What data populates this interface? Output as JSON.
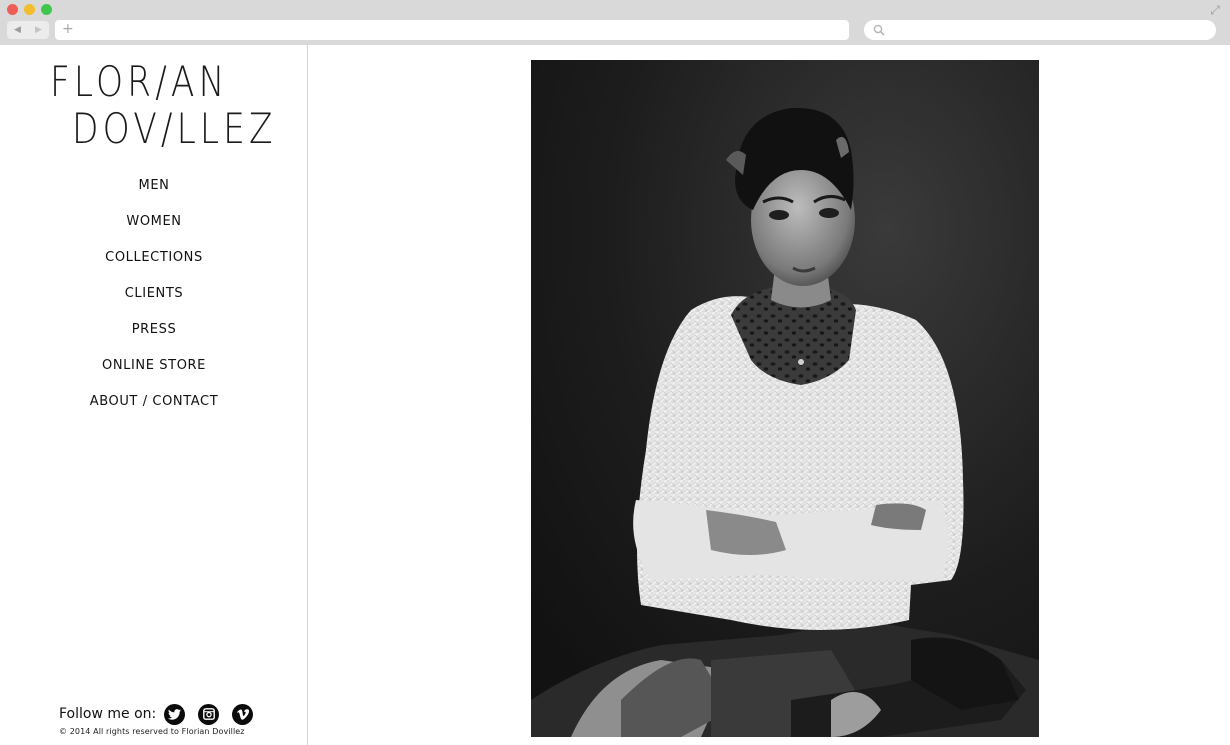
{
  "browser": {
    "back_label": "◀",
    "forward_label": "▶",
    "new_tab_label": "+",
    "expand_label": "⤢",
    "address_value": "",
    "search_value": ""
  },
  "site": {
    "logo_line1": "FLOR/AN",
    "logo_line2": "DOV/LLEZ"
  },
  "nav": {
    "items": [
      {
        "label": "MEN"
      },
      {
        "label": "WOMEN"
      },
      {
        "label": "COLLECTIONS"
      },
      {
        "label": "CLIENTS"
      },
      {
        "label": "PRESS"
      },
      {
        "label": "ONLINE STORE"
      },
      {
        "label": "ABOUT / CONTACT"
      }
    ]
  },
  "footer": {
    "follow_label": "Follow me on:",
    "social": [
      {
        "icon": "twitter-icon"
      },
      {
        "icon": "instagram-icon"
      },
      {
        "icon": "vimeo-icon"
      }
    ],
    "copyright": "© 2014 All rights reserved to Florian Dovillez"
  },
  "photo": {
    "subject": "black-and-white portrait photograph"
  },
  "colors": {
    "chrome_bg": "#d9d9d9",
    "text": "#111111",
    "close": "#ee5e57",
    "minimize": "#f2be2e",
    "maximize": "#3fc64d"
  }
}
